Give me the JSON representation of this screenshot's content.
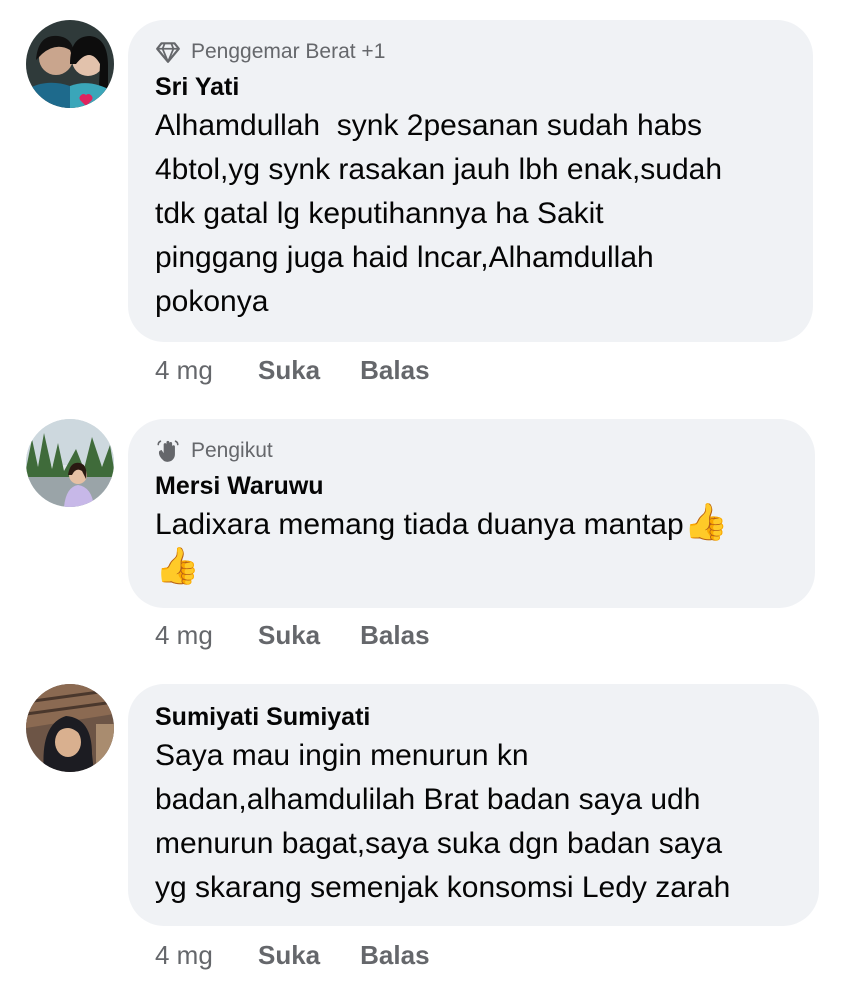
{
  "comments": [
    {
      "badge": "Penggemar Berat +1",
      "badge_icon": "diamond-icon",
      "name": "Sri Yati",
      "text": "Alhamdullah  synk 2pesanan sudah habs\n4btol,yg synk rasakan jauh lbh enak,sudah\ntdk gatal lg keputihannya ha Sakit\npinggang juga haid lncar,Alhamdullah\npokonya",
      "time": "4 mg",
      "like": "Suka",
      "reply": "Balas"
    },
    {
      "badge": "Pengikut",
      "badge_icon": "waving-hand-icon",
      "name": "Mersi Waruwu",
      "text": "Ladixara memang tiada duanya mantap",
      "emoji": "👍",
      "emoji2": "👍",
      "time": "4 mg",
      "like": "Suka",
      "reply": "Balas"
    },
    {
      "name": "Sumiyati Sumiyati",
      "text": "Saya mau ingin menurun kn\nbadan,alhamdulilah Brat badan saya udh\nmenurun bagat,saya suka dgn badan saya\nyg skarang semenjak konsomsi Ledy zarah",
      "time": "4 mg",
      "like": "Suka",
      "reply": "Balas"
    }
  ]
}
